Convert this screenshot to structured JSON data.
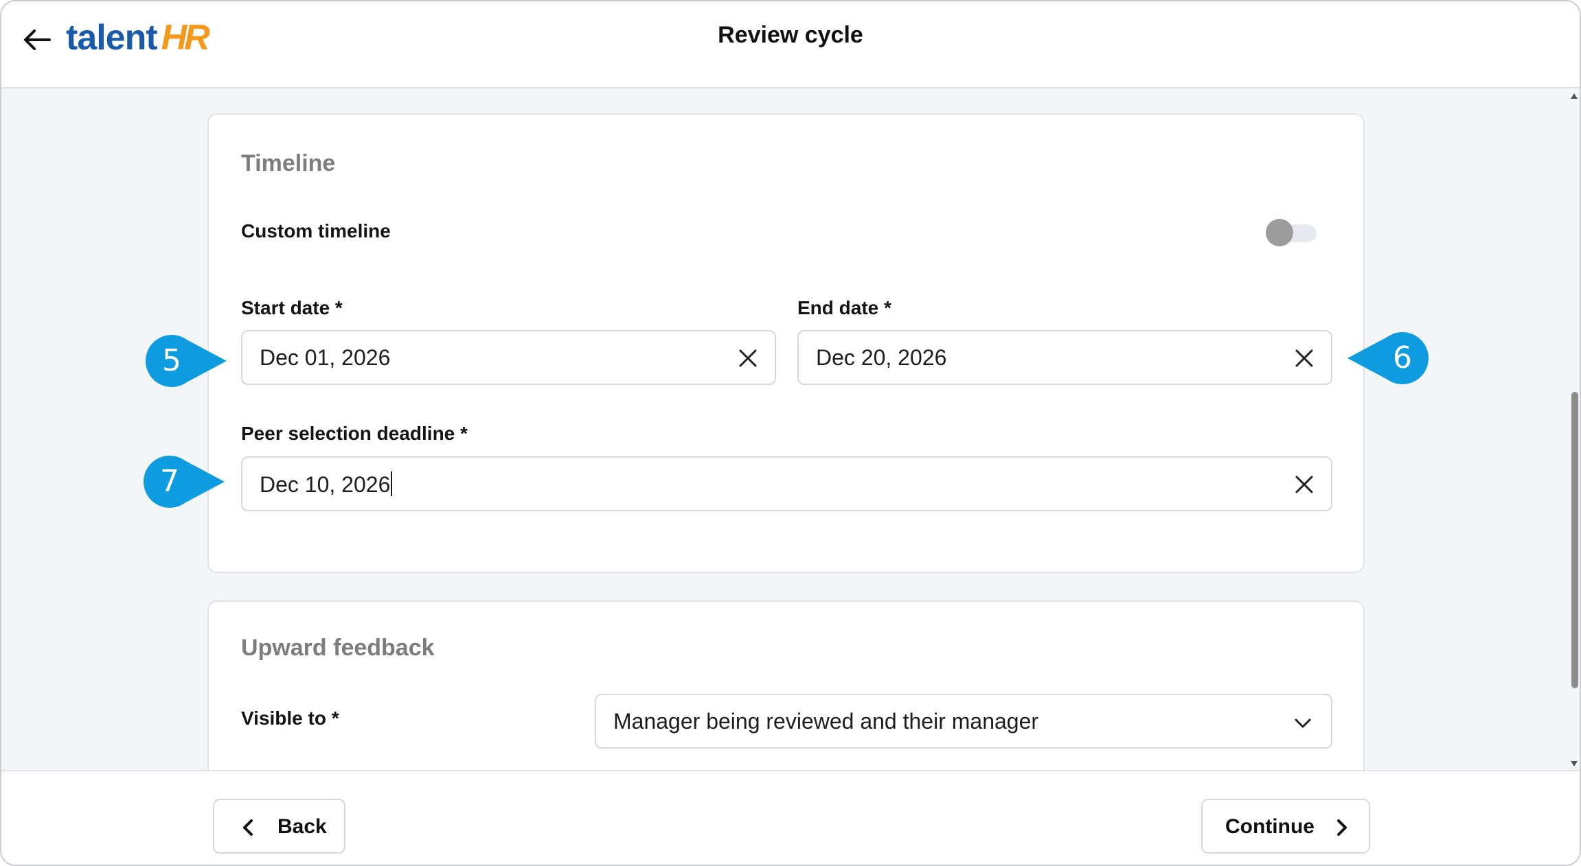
{
  "header": {
    "logo_main": "talent",
    "logo_accent": "HR",
    "title": "Review cycle"
  },
  "timeline": {
    "section_title": "Timeline",
    "custom_timeline_label": "Custom timeline",
    "custom_timeline_enabled": false,
    "start_date_label": "Start date *",
    "start_date_value": "Dec 01, 2026",
    "end_date_label": "End date *",
    "end_date_value": "Dec 20, 2026",
    "peer_deadline_label": "Peer selection deadline *",
    "peer_deadline_value": "Dec 10, 2026"
  },
  "upward_feedback": {
    "section_title": "Upward feedback",
    "visible_to_label": "Visible to *",
    "visible_to_value": "Manager being reviewed and their manager"
  },
  "callouts": [
    "5",
    "6",
    "7"
  ],
  "footer": {
    "back_label": "Back",
    "continue_label": "Continue"
  },
  "colors": {
    "brand_blue": "#1a5aa8",
    "brand_orange": "#f39a1d",
    "callout_blue": "#0f9be0",
    "page_bg": "#f4f5f7"
  },
  "icons": [
    "back-arrow-icon",
    "close-icon",
    "chevron-down-icon",
    "chevron-left-icon",
    "chevron-right-icon"
  ]
}
